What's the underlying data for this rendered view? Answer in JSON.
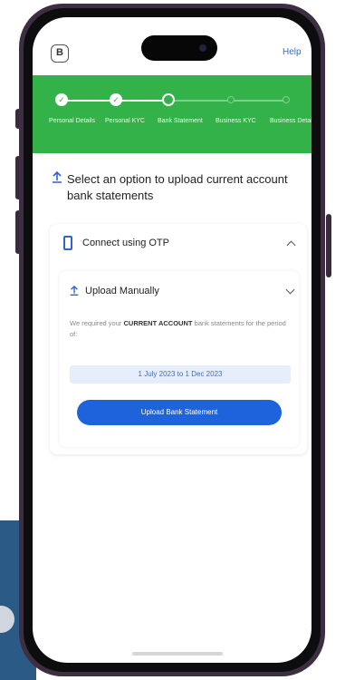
{
  "header": {
    "help_label": "Help",
    "logo_glyph": "B"
  },
  "stepper": {
    "steps": [
      {
        "label": "Personal Details",
        "state": "done"
      },
      {
        "label": "Personal KYC",
        "state": "done"
      },
      {
        "label": "Bank Statement",
        "state": "active"
      },
      {
        "label": "Business KYC",
        "state": "todo"
      },
      {
        "label": "Business Details",
        "state": "todo"
      }
    ],
    "color": "#33b249"
  },
  "main": {
    "heading": "Select an option to upload current account bank statements",
    "otp": {
      "label": "Connect using OTP",
      "expanded": false
    },
    "manual": {
      "label": "Upload Manually",
      "note_prefix": "We required your",
      "note_bold": "CURRENT ACCOUNT",
      "note_suffix": "bank statements for the period of:",
      "period": "1 July 2023 to 1 Dec 2023",
      "button_label": "Upload Bank Statement"
    }
  },
  "icons": {
    "help": "help-link",
    "heading": "upload-icon",
    "otp": "phone-icon",
    "manual": "upload-icon",
    "otp_chevron": "chevron-up-icon",
    "manual_chevron": "chevron-down-icon"
  },
  "colors": {
    "accent": "#1f63dc",
    "green": "#33b249",
    "frame": "#3d2e42"
  }
}
